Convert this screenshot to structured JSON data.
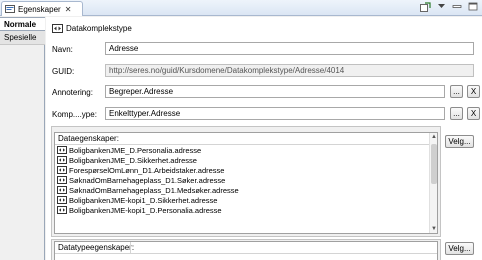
{
  "view": {
    "title": "Egenskaper",
    "close_glyph": "✕"
  },
  "toolbar": {
    "icons": [
      "new-view-icon",
      "view-menu-icon",
      "minimize-icon",
      "maximize-icon"
    ]
  },
  "sidebar": {
    "tabs": [
      {
        "label": "Normale",
        "active": true
      },
      {
        "label": "Spesielle",
        "active": false
      }
    ]
  },
  "header": {
    "type_label": "Datakomplekstype"
  },
  "form": {
    "navn": {
      "label": "Navn:",
      "value": "Adresse"
    },
    "guid": {
      "label": "GUID:",
      "value": "http://seres.no/guid/Kursdomene/Datakomplekstype/Adresse/4014"
    },
    "annotering": {
      "label": "Annotering:",
      "value": "Begreper.Adresse",
      "browse": "...",
      "clear": "X"
    },
    "komponenttype": {
      "label": "Komp....ype:",
      "value": "Enkelttyper.Adresse",
      "browse": "...",
      "clear": "X"
    }
  },
  "dataegenskaper": {
    "header": "Dataegenskaper:",
    "button": "Velg...",
    "rows": [
      "BoligbankenJME_D.Personalia.adresse",
      "BoligbankenJME_D.Sikkerhet.adresse",
      "ForespørselOmLønn_D1.Arbeidstaker.adresse",
      "SøknadOmBarnehageplass_D1.Søker.adresse",
      "SøknadOmBarnehageplass_D1.Medsøker.adresse",
      "BoligbankenJME-kopi1_D.Sikkerhet.adresse",
      "BoligbankenJME-kopi1_D.Personalia.adresse"
    ]
  },
  "datatypeegenskaper": {
    "header": "Datatypeegenskaper:",
    "button": "Velg..."
  },
  "colors": {
    "accent": "#3b6fb6",
    "window_bg": "#f0f0f0"
  }
}
